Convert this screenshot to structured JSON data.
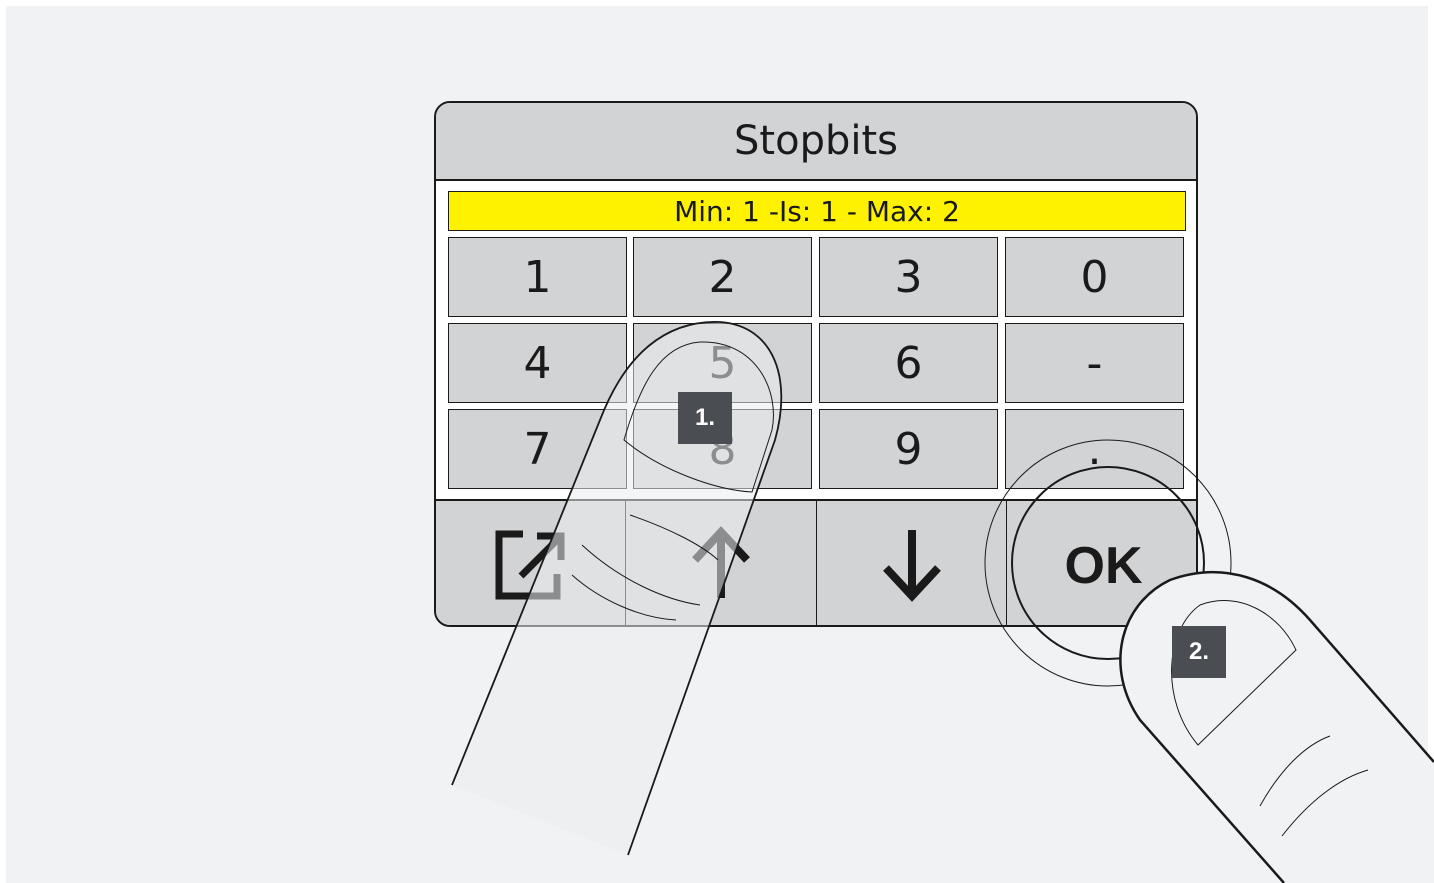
{
  "screen": {
    "title": "Stopbits",
    "range_text": "Min: 1 -Is: 1 - Max: 2"
  },
  "keypad": {
    "keys": [
      "1",
      "2",
      "3",
      "0",
      "4",
      "5",
      "6",
      "-",
      "7",
      "8",
      "9",
      "."
    ]
  },
  "nav": {
    "exit_icon": "exit-icon",
    "up_icon": "arrow-up-icon",
    "down_icon": "arrow-down-icon",
    "ok_label": "OK"
  },
  "steps": {
    "step1": "1.",
    "step2": "2."
  },
  "colors": {
    "highlight": "#fff200",
    "panel_gray": "#d2d3d5",
    "badge": "#4a4d52"
  }
}
